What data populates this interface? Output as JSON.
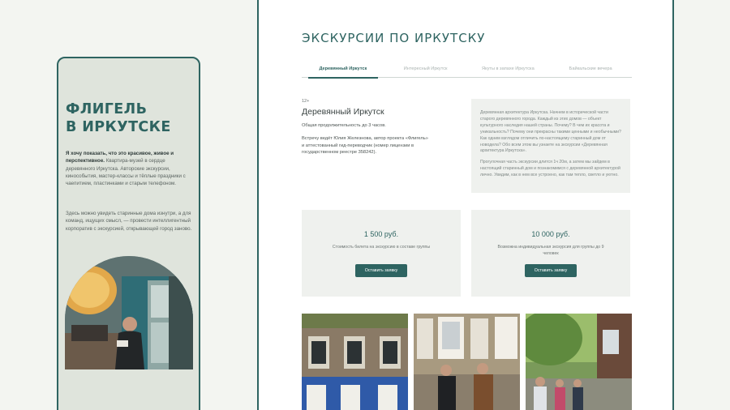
{
  "left_card": {
    "title_line1": "ФЛИГЕЛЬ",
    "title_line2": "В ИРКУТСКЕ",
    "intro_bold": "Я хочу показать, что это красивое, живое и перспективное.",
    "intro_text": "Квартира-музей в сердце деревянного Иркутска. Авторские экскурсии, кинособытия, мастер-классы и тёплые праздники с чаепитием, пластинками и старым телефоном.",
    "second_text": "Здесь можно увидеть старинные дома изнутри, а для команд, ищущих смысл, — провести интеллигентный корпоратив с экскурсией, открывающей город заново."
  },
  "main": {
    "title": "ЭКСКУРСИИ ПО ИРКУТСКУ",
    "tabs": [
      {
        "label": "Деревянный Иркутск",
        "active": true
      },
      {
        "label": "Интересный Иркутск",
        "active": false
      },
      {
        "label": "Якуты в запахе Иркутска",
        "active": false
      },
      {
        "label": "Байкальские вечера",
        "active": false
      }
    ],
    "age": "12+",
    "tour_title": "Деревянный Иркутск",
    "duration": "Общая продолжительность до 3 часов.",
    "guide": "Встречу ведёт Юлия Железнова, автор проекта «Флигель» и аттестованный гид-переводчик (номер лицензии в государственном реестре 358242).",
    "info_p1": "Деревянная архитектура Иркутска. Начнем в исторической части старого деревянного города. Каждый из этих домов — объект культурного наследия нашей страны. Почему? В чем их красота и уникальность? Почему они прекрасны такими ценными и необычными? Как одним взглядом отличить по-настоящему старинный дом от новодела? Обо всем этом вы узнаете на экскурсии «Деревянная архитектура Иркутска».",
    "info_p2": "Прогулочная часть экскурсии длится 1ч 20м, а затем мы зайдем в настоящий старинный дом и познакомимся с деревянной архитектурой лично. Увидим, как в нем все устроено, как там тепло, светло и уютно.",
    "prices": [
      {
        "price": "1 500 руб.",
        "desc": "Стоимость билета на экскурсию в составе группы",
        "button": "Оставить заявку"
      },
      {
        "price": "10 000 руб.",
        "desc": "Возможна индивидуальная экскурсия для группы до 9 человек",
        "button": "Оставить заявку"
      }
    ]
  },
  "colors": {
    "accent": "#2e6461",
    "page_bg": "#f3f5f1",
    "card_bg": "#dfe4dc",
    "box_bg": "#eff1ee"
  }
}
